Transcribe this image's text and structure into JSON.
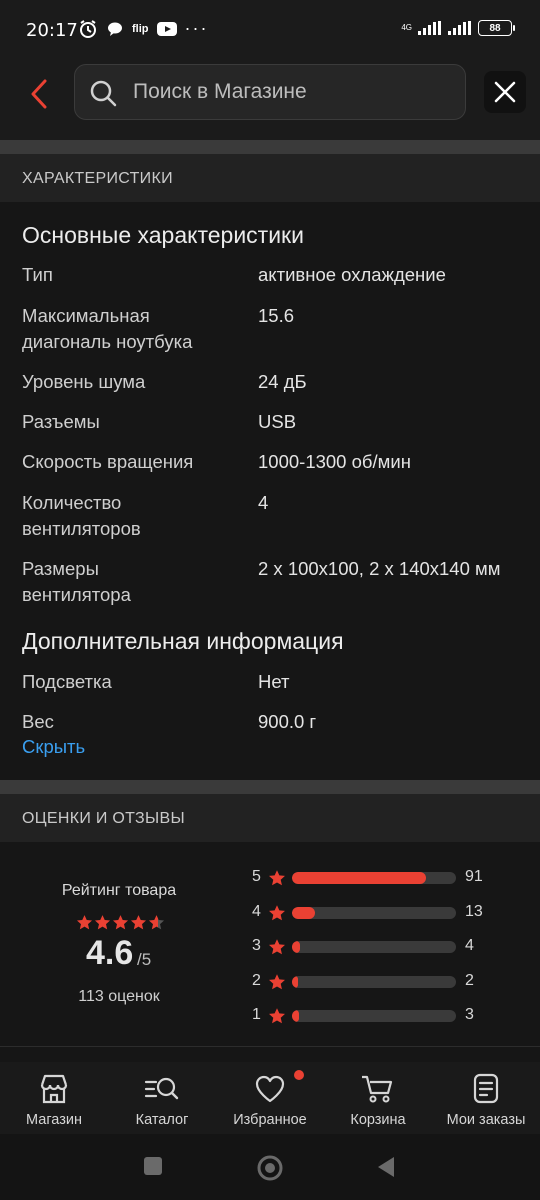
{
  "status_bar": {
    "time": "20:17",
    "flip_label": "flip",
    "battery": "88",
    "network": "4G"
  },
  "search": {
    "placeholder": "Поиск в Магазине"
  },
  "characteristics": {
    "section_title": "ХАРАКТЕРИСТИКИ",
    "main_title": "Основные характеристики",
    "main_rows": [
      {
        "label": "Тип",
        "value": "активное охлаждение"
      },
      {
        "label": "Максимальная диагональ ноутбука",
        "value": "15.6"
      },
      {
        "label": "Уровень шума",
        "value": "24 дБ"
      },
      {
        "label": "Разъемы",
        "value": "USB"
      },
      {
        "label": "Скорость вращения",
        "value": "1000-1300 об/мин"
      },
      {
        "label": "Количество вентиляторов",
        "value": "4"
      },
      {
        "label": "Размеры вентилятора",
        "value": "2 x 100x100, 2 x 140x140 мм"
      }
    ],
    "extra_title": "Дополнительная информация",
    "extra_rows": [
      {
        "label": "Подсветка",
        "value": "Нет"
      },
      {
        "label": "Вес",
        "value": "900.0 г"
      }
    ],
    "hide_link": "Скрыть"
  },
  "reviews": {
    "section_title": "ОЦЕНКИ И ОТЗЫВЫ",
    "rating_label": "Рейтинг товара",
    "rating_value": "4.6",
    "rating_max": "/5",
    "rating_count": "113 оценок",
    "stars_filled": 4.6,
    "distribution": [
      {
        "stars": "5",
        "count": "91",
        "fill": 0.82
      },
      {
        "stars": "4",
        "count": "13",
        "fill": 0.14
      },
      {
        "stars": "3",
        "count": "4",
        "fill": 0.05
      },
      {
        "stars": "2",
        "count": "2",
        "fill": 0.03
      },
      {
        "stars": "1",
        "count": "3",
        "fill": 0.04
      }
    ]
  },
  "bottom_nav": [
    {
      "label": "Магазин",
      "icon": "store-icon"
    },
    {
      "label": "Каталог",
      "icon": "catalog-search-icon"
    },
    {
      "label": "Избранное",
      "icon": "heart-icon"
    },
    {
      "label": "Корзина",
      "icon": "cart-icon"
    },
    {
      "label": "Мои заказы",
      "icon": "orders-icon"
    }
  ],
  "colors": {
    "accent": "#ea4133",
    "link": "#3a9ff0",
    "background": "#161616"
  }
}
